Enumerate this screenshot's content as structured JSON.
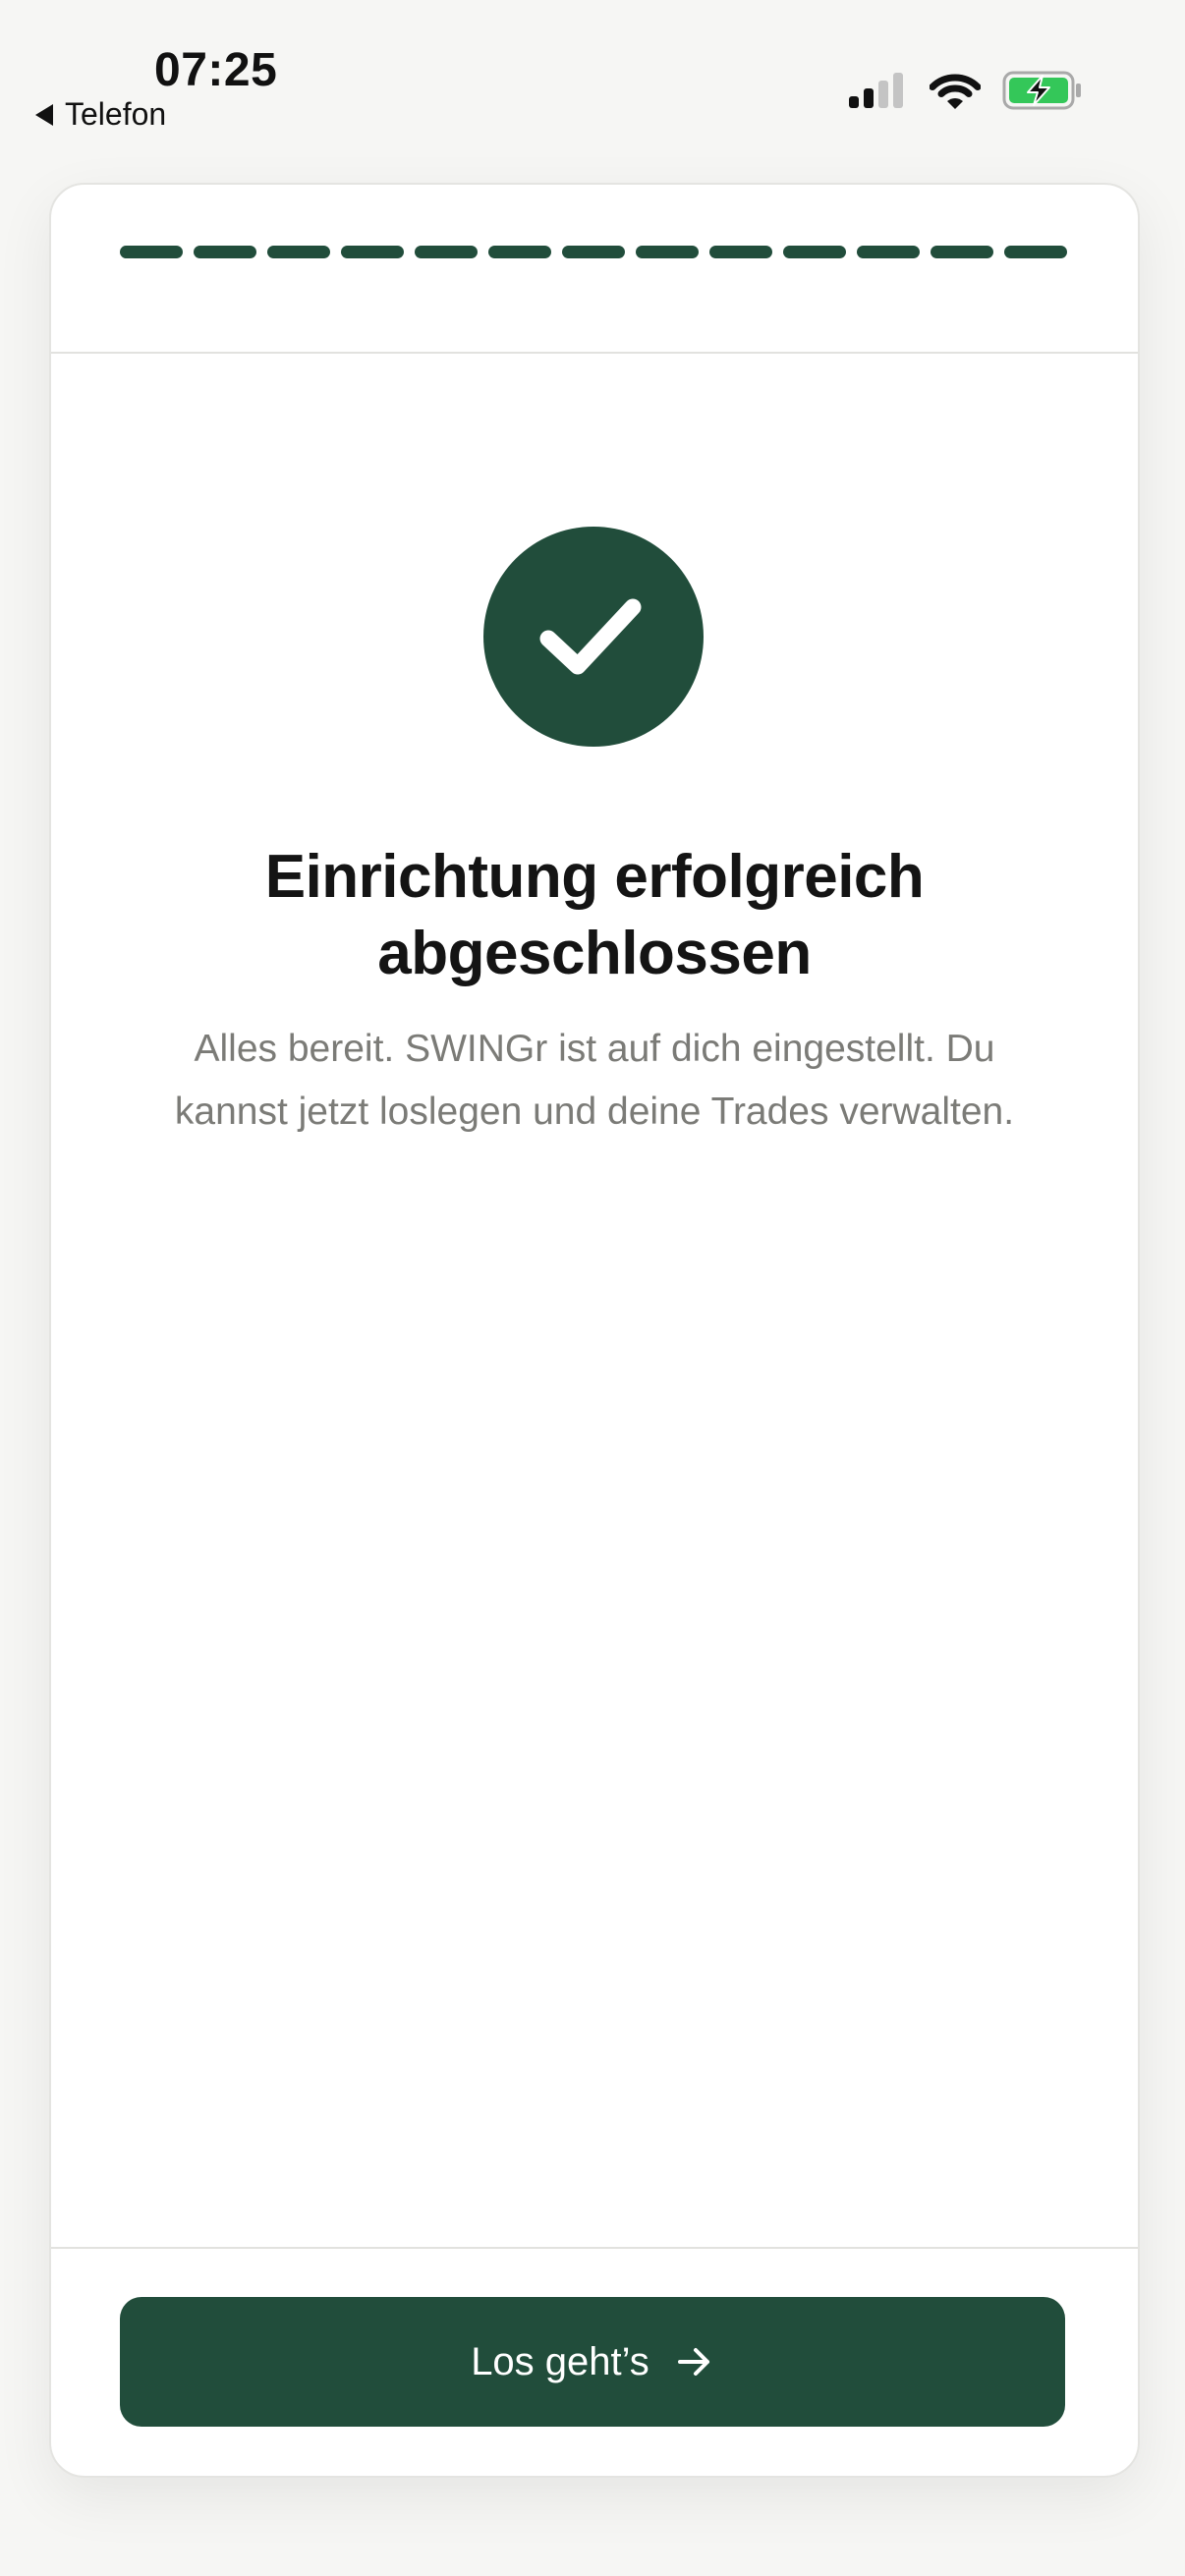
{
  "status_bar": {
    "time": "07:25",
    "back_label": "Telefon",
    "icons": [
      "cellular-signal-icon",
      "wifi-icon",
      "battery-charging-icon"
    ]
  },
  "progress": {
    "steps_total": 13,
    "steps_completed": 13
  },
  "main": {
    "icon": "checkmark-icon",
    "title": "Einrichtung erfolgreich abgeschlossen",
    "subtitle": "Alles bereit. SWINGr ist auf dich eingestellt. Du kannst jetzt loslegen und deine Trades verwalten."
  },
  "footer": {
    "button_label": "Los geht’s",
    "button_icon": "arrow-right-icon"
  },
  "colors": {
    "accent": "#214d3b",
    "background": "#f6f6f4",
    "card": "#ffffff",
    "subtitle_text": "#7b7b77",
    "battery_fill": "#34c759"
  }
}
